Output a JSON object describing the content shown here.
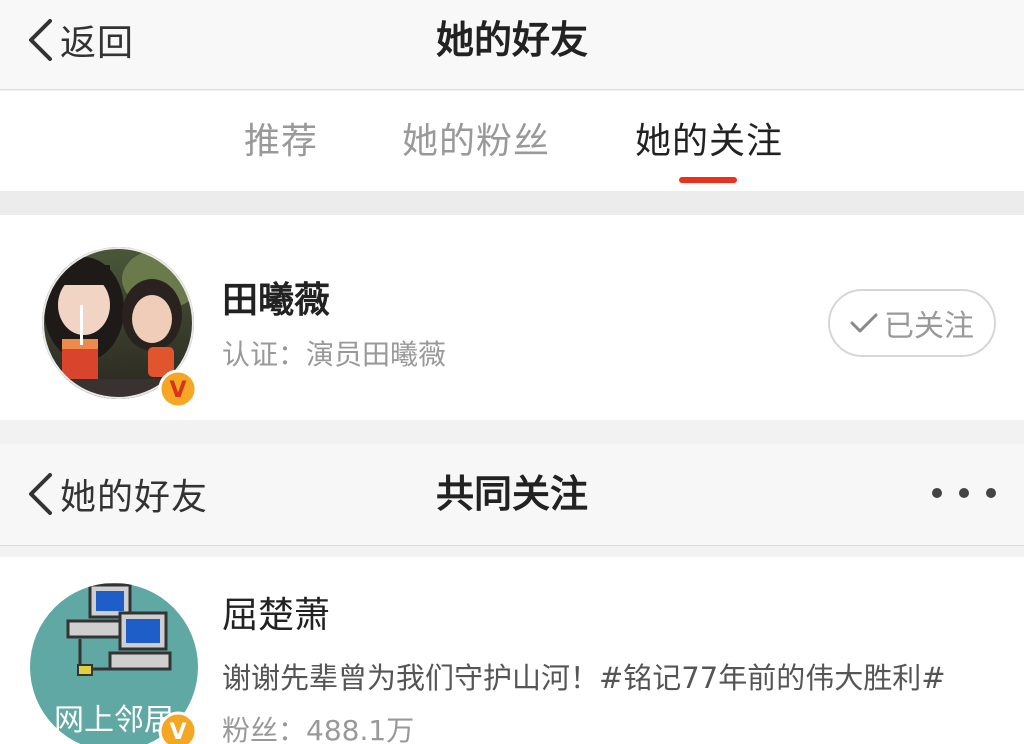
{
  "nav": {
    "back_label": "返回",
    "title": "她的好友"
  },
  "tabs": [
    {
      "label": "推荐",
      "active": false
    },
    {
      "label": "她的粉丝",
      "active": false
    },
    {
      "label": "她的关注",
      "active": true
    }
  ],
  "profile": {
    "name": "田曦薇",
    "certification": "认证：演员田曦薇",
    "follow_label": "已关注",
    "verified_badge": "V"
  },
  "subnav": {
    "back_label": "她的好友",
    "title": "共同关注"
  },
  "list": [
    {
      "name": "屈楚萧",
      "description": "谢谢先辈曾为我们守护山河！#铭记77年前的伟大胜利#",
      "fans": "粉丝：488.1万",
      "avatar_text": "网上邻居",
      "verified_badge": "V"
    }
  ],
  "colors": {
    "accent": "#e8321e",
    "badge": "#f5a623",
    "avatar2_bg": "#5fa8a4"
  }
}
